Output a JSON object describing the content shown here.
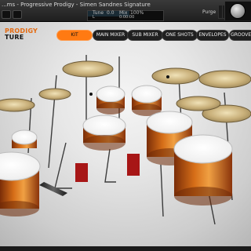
{
  "window": {
    "title": "...ms - Progressive Prodigy - Simen Sandnes Signature",
    "tune_label": "Tune",
    "tune_value": "0.0",
    "mix_label": "Mix",
    "mix_value": "100%",
    "left_label": "L",
    "time_value": "0:00:00",
    "purge_label": "Purge"
  },
  "brand": {
    "line1": "PRODIGY",
    "line2": "TURE"
  },
  "tabs": [
    {
      "label": "KIT",
      "active": true
    },
    {
      "label": "MAIN MIXER",
      "active": false
    },
    {
      "label": "SUB MIXER",
      "active": false
    },
    {
      "label": "ONE SHOTS",
      "active": false
    },
    {
      "label": "ENVELOPES",
      "active": false
    },
    {
      "label": "GROOVES",
      "active": false
    }
  ],
  "colors": {
    "accent": "#ff7a12",
    "brand_orange": "#e46b12"
  }
}
